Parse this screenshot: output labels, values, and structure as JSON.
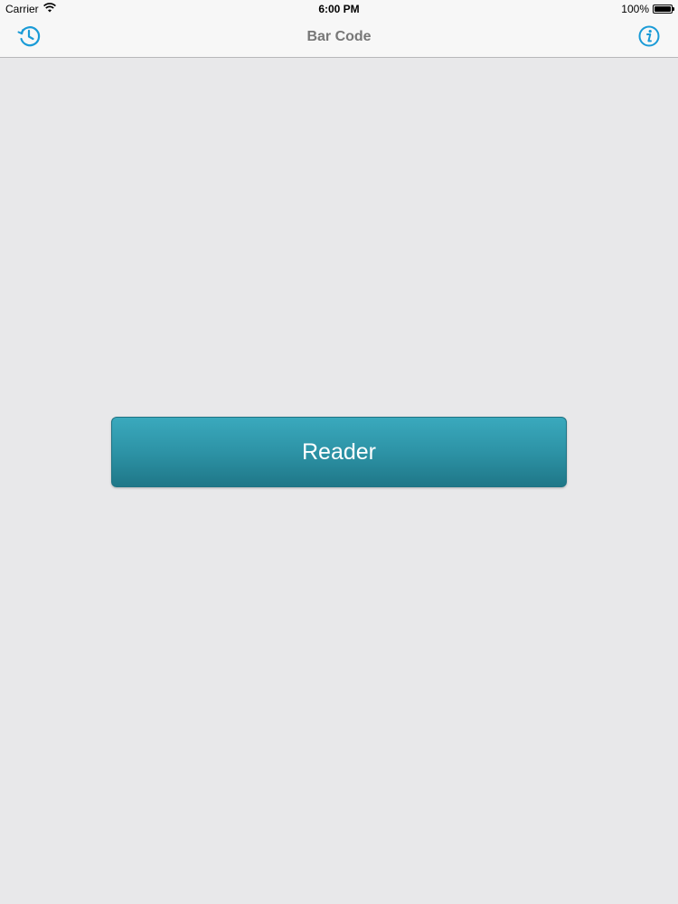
{
  "status_bar": {
    "carrier": "Carrier",
    "time": "6:00 PM",
    "battery_percent": "100%",
    "battery_level": 1.0,
    "wifi_icon": "wifi-icon"
  },
  "nav_bar": {
    "title": "Bar Code",
    "left_icon": "history-clock-icon",
    "right_icon": "info-icon"
  },
  "main": {
    "reader_button_label": "Reader"
  },
  "colors": {
    "accent": "#1a9bd7",
    "button_top": "#3aa9bd",
    "button_bottom": "#1f7788",
    "background": "#e8e8ea"
  }
}
